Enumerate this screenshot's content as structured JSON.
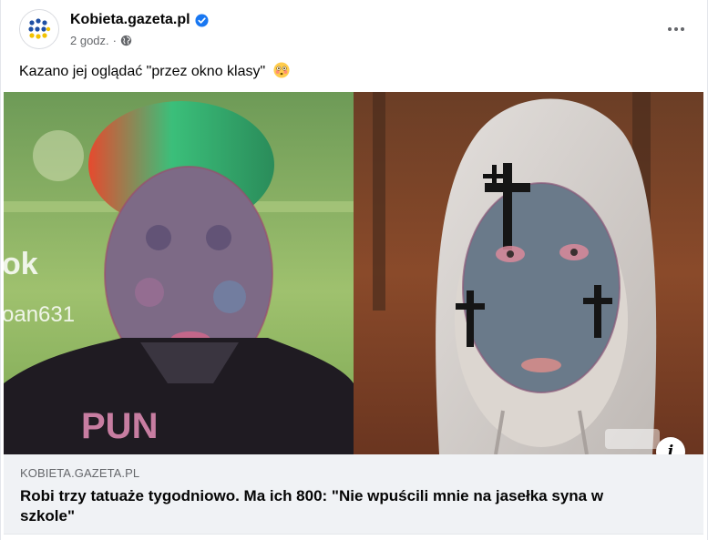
{
  "post": {
    "page_name": "Kobieta.gazeta.pl",
    "time": "2 godz.",
    "separator": "·",
    "text": "Kazano jej oglądać \"przez okno klasy\"",
    "emoji": "flushed-face-emoji"
  },
  "media": {
    "watermark_left": "ok",
    "watermark_left_sub": "oan631",
    "info_label": "i"
  },
  "link": {
    "domain": "KOBIETA.GAZETA.PL",
    "title": "Robi trzy tatuaże tygodniowo. Ma ich 800: \"Nie wpuścili mnie na jasełka syna w szkole\""
  },
  "icons": {
    "verified": "verified-badge-icon",
    "privacy": "globe-icon",
    "more": "more-options-icon",
    "info": "info-icon"
  },
  "colors": {
    "accent": "#1877f2",
    "secondary_text": "#65676b",
    "preview_bg": "#f0f2f5"
  }
}
